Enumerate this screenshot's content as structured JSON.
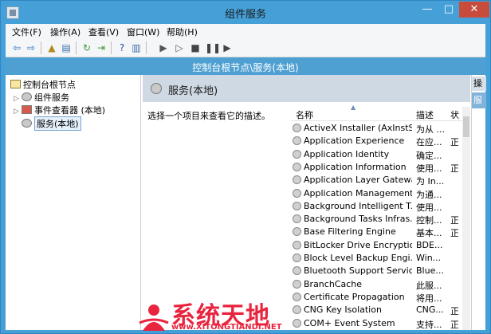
{
  "window": {
    "title": "组件服务",
    "minimize": "—",
    "maximize": "□",
    "close": "✕"
  },
  "menubar": {
    "items": [
      "文件(F)",
      "操作(A)",
      "查看(V)",
      "窗口(W)",
      "帮助(H)"
    ]
  },
  "toolbar": {
    "icons": [
      "back-icon",
      "forward-icon",
      "up-folder-icon",
      "show-hide-tree-icon",
      "refresh-icon",
      "export-icon",
      "help-icon",
      "show-hide-action-icon",
      "play-icon",
      "play-alt-icon",
      "stop-icon",
      "pause-icon",
      "restart-icon"
    ]
  },
  "pathbar": {
    "text": "控制台根节点\\服务(本地)"
  },
  "tree": {
    "root": "控制台根节点",
    "items": [
      {
        "label": "组件服务",
        "expander": "▷"
      },
      {
        "label": "事件查看器 (本地)",
        "expander": "▷"
      },
      {
        "label": "服务(本地)",
        "expander": ""
      }
    ]
  },
  "center": {
    "title": "服务(本地)",
    "description": "选择一个项目来查看它的描述。",
    "columns": {
      "name": "名称",
      "desc": "描述",
      "extra": "状"
    },
    "sort_caret": "▲",
    "services": [
      {
        "name": "ActiveX Installer (AxInstSV)",
        "desc": "为从 ...",
        "x": ""
      },
      {
        "name": "Application Experience",
        "desc": "在应...",
        "x": "正"
      },
      {
        "name": "Application Identity",
        "desc": "确定...",
        "x": ""
      },
      {
        "name": "Application Information",
        "desc": "使用...",
        "x": "正"
      },
      {
        "name": "Application Layer Gatewa...",
        "desc": "为 In...",
        "x": ""
      },
      {
        "name": "Application Management",
        "desc": "为通...",
        "x": ""
      },
      {
        "name": "Background Intelligent T...",
        "desc": "使用...",
        "x": ""
      },
      {
        "name": "Background Tasks Infras...",
        "desc": "控制...",
        "x": "正"
      },
      {
        "name": "Base Filtering Engine",
        "desc": "基本...",
        "x": "正"
      },
      {
        "name": "BitLocker Drive Encryptio...",
        "desc": "BDE...",
        "x": ""
      },
      {
        "name": "Block Level Backup Engi...",
        "desc": "Win...",
        "x": ""
      },
      {
        "name": "Bluetooth Support Service",
        "desc": "Blue...",
        "x": ""
      },
      {
        "name": "BranchCache",
        "desc": "此服...",
        "x": ""
      },
      {
        "name": "Certificate Propagation",
        "desc": "将用...",
        "x": ""
      },
      {
        "name": "CNG Key Isolation",
        "desc": "CNG...",
        "x": "正"
      },
      {
        "name": "COM+ Event System",
        "desc": "支持...",
        "x": "正"
      }
    ]
  },
  "actions": {
    "header": "操",
    "sub": "服"
  },
  "watermark": {
    "text": "系统天地",
    "url": "www.XITONGTIANDI.NET"
  },
  "colors": {
    "titlebar": "#46a0d8",
    "pathbar": "#4fa0d2",
    "close": "#c74c3c",
    "watermark": "#e8243e"
  }
}
